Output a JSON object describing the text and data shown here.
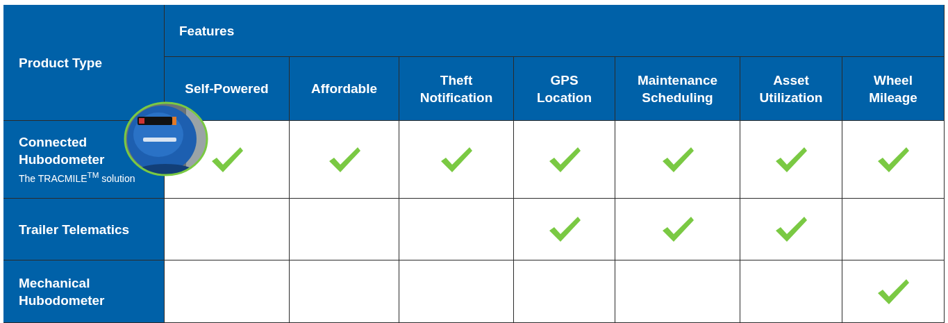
{
  "table": {
    "corner_heading": "Product Type",
    "group_heading": "Features",
    "columns": [
      "Self-Powered",
      "Affordable",
      "Theft Notification",
      "GPS Location",
      "Maintenance Scheduling",
      "Asset Utilization",
      "Wheel Mileage"
    ],
    "rows": [
      {
        "name": "Connected Hubodometer",
        "subtitle": "The TRACMILE$^{TM}$ solution",
        "checks": [
          true,
          true,
          true,
          true,
          true,
          true,
          true
        ]
      },
      {
        "name": "Trailer Telematics",
        "checks": [
          false,
          false,
          false,
          true,
          true,
          true,
          false
        ]
      },
      {
        "name": "Mechanical Hubodometer",
        "checks": [
          false,
          false,
          false,
          false,
          false,
          false,
          true
        ]
      }
    ]
  }
}
